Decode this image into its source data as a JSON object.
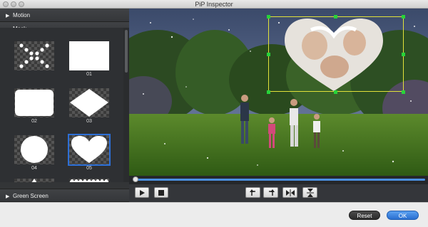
{
  "window": {
    "title": "PiP Inspector"
  },
  "sidebar": {
    "sections": [
      {
        "label": "Motion",
        "expanded": false
      },
      {
        "label": "Mask",
        "expanded": true
      },
      {
        "label": "Green Screen",
        "expanded": false
      }
    ],
    "masks": [
      {
        "label": "",
        "shape": "x-dots"
      },
      {
        "label": "01",
        "shape": "rectangle"
      },
      {
        "label": "02",
        "shape": "rounded-rectangle"
      },
      {
        "label": "03",
        "shape": "diamond"
      },
      {
        "label": "04",
        "shape": "circle"
      },
      {
        "label": "05",
        "shape": "heart",
        "selected": true
      }
    ]
  },
  "playback": {
    "progress": 0.0
  },
  "footer": {
    "reset_label": "Reset",
    "ok_label": "OK"
  },
  "colors": {
    "accent": "#2d6fd6",
    "pip_frame": "#e2e23a",
    "handles": "#27d33a"
  }
}
